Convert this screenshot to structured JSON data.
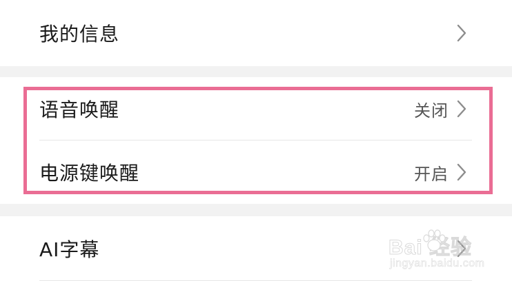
{
  "settings": {
    "rows": [
      {
        "label": "我的信息",
        "value": ""
      },
      {
        "label": "语音唤醒",
        "value": "关闭"
      },
      {
        "label": "电源键唤醒",
        "value": "开启"
      },
      {
        "label": "AI字幕",
        "value": ""
      }
    ]
  },
  "watermark": {
    "brand": "Bai  经验",
    "url": "jingyan.baidu.com"
  },
  "colors": {
    "highlight_border": "#ea6d94",
    "background": "#f2f2f2",
    "row_background": "#ffffff",
    "chevron": "#8c8c8c"
  },
  "icons": {
    "chevron": "chevron-right-icon",
    "watermark_logo": "baidu-paw-icon"
  }
}
